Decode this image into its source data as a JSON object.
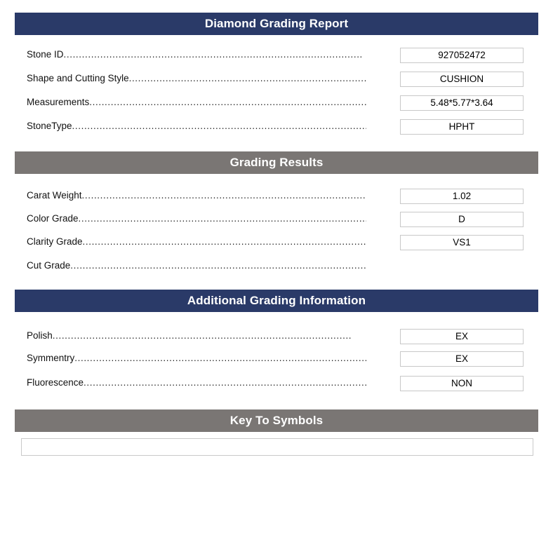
{
  "document": {
    "title": "Diamond Grading Report"
  },
  "colors": {
    "navy": "#2a3a68",
    "grey": "#7a7674",
    "box_border": "#c8c8c8",
    "text": "#111111"
  },
  "leader": "..................................................................................................",
  "sections": [
    {
      "id": "diamond-grading-report",
      "heading": "Diamond Grading Report",
      "style": "navy",
      "rows": [
        {
          "label": "Stone ID",
          "value": "927052472",
          "has_box": true
        },
        {
          "label": "Shape and Cutting Style",
          "value": "CUSHION",
          "has_box": true
        },
        {
          "label": "Measurements",
          "value": "5.48*5.77*3.64",
          "has_box": true
        },
        {
          "label": "StoneType",
          "value": "HPHT",
          "has_box": true
        }
      ]
    },
    {
      "id": "grading-results",
      "heading": "Grading Results",
      "style": "grey",
      "rows": [
        {
          "label": "Carat Weight",
          "value": "1.02",
          "has_box": true
        },
        {
          "label": "Color Grade",
          "value": "D",
          "has_box": true
        },
        {
          "label": "Clarity Grade",
          "value": "VS1",
          "has_box": true
        },
        {
          "label": "Cut Grade",
          "value": "",
          "has_box": false
        }
      ]
    },
    {
      "id": "additional-grading-information",
      "heading": "Additional Grading Information",
      "style": "navy",
      "rows": [
        {
          "label": "Polish",
          "value": "EX",
          "has_box": true
        },
        {
          "label": "Symmentry",
          "value": "EX",
          "has_box": true
        },
        {
          "label": "Fluorescence",
          "value": "NON",
          "has_box": true
        }
      ]
    },
    {
      "id": "key-to-symbols",
      "heading": "Key To Symbols",
      "style": "grey",
      "rows": [],
      "symbols_box": {
        "content": ""
      }
    }
  ]
}
